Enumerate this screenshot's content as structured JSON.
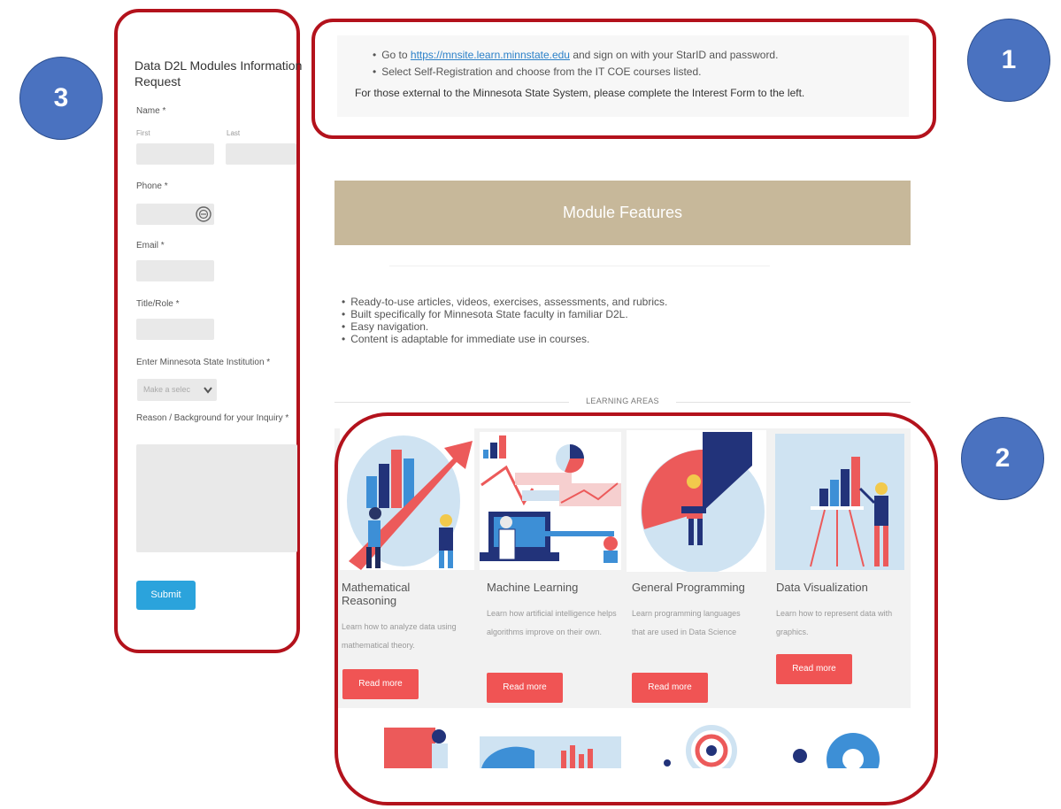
{
  "form": {
    "title": "Data D2L Modules Information Request",
    "name_label": "Name *",
    "first_label": "First",
    "last_label": "Last",
    "phone_label": "Phone *",
    "email_label": "Email *",
    "title_role_label": "Title/Role *",
    "institution_label": "Enter Minnesota State Institution *",
    "institution_placeholder": "Make a selec",
    "reason_label": "Reason / Background for your Inquiry *",
    "submit_label": "Submit"
  },
  "info": {
    "bullet1_prefix": "Go to ",
    "bullet1_link": "https://mnsite.learn.minnstate.edu",
    "bullet1_suffix": " and sign on with your StarID and password.",
    "bullet2": "Select Self-Registration and choose from the IT COE courses listed.",
    "external_note": "For those external to the Minnesota State System, please complete the Interest Form to the left."
  },
  "features": {
    "banner": "Module Features",
    "items": [
      "Ready-to-use articles, videos, exercises, assessments, and rubrics.",
      "Built specifically for Minnesota State faculty in familiar D2L.",
      "Easy navigation.",
      "Content is adaptable for immediate use in courses."
    ]
  },
  "learning_areas": {
    "heading": "LEARNING AREAS",
    "cards": [
      {
        "title": "Mathematical Reasoning",
        "desc": "Learn how to analyze data using mathematical theory.",
        "button": "Read more"
      },
      {
        "title": "Machine Learning",
        "desc": "Learn how artificial intelligence helps algorithms improve on their own.",
        "button": "Read more"
      },
      {
        "title": "General Programming",
        "desc": "Learn programming languages that are used in Data Science",
        "button": "Read more"
      },
      {
        "title": "Data Visualization",
        "desc": "Learn how to represent data with graphics.",
        "button": "Read more"
      }
    ]
  },
  "callouts": [
    "3",
    "1",
    "2"
  ],
  "colors": {
    "outline": "#b3121c",
    "callout": "#4a72c0",
    "banner": "#c7b89a",
    "button": "#f05454",
    "submit": "#2ba3dc"
  }
}
